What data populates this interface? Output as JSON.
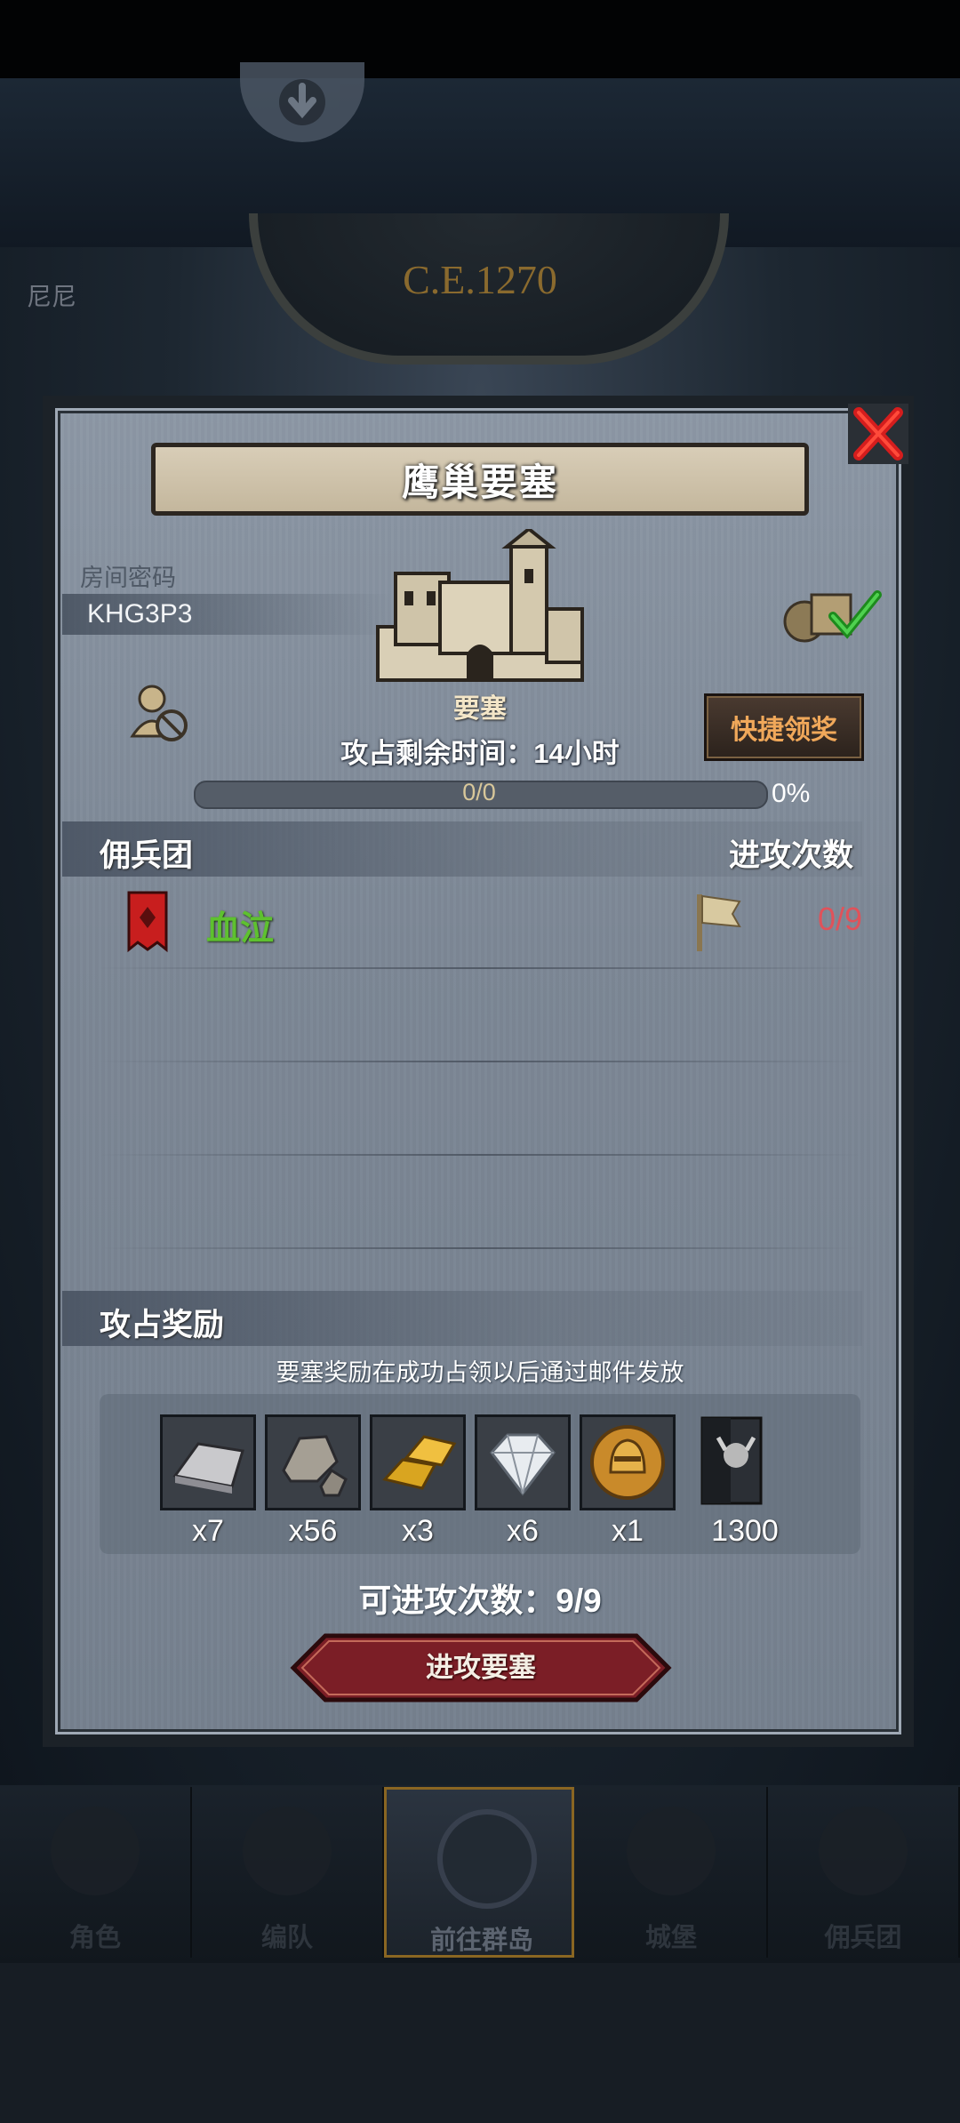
{
  "top": {
    "scroll_icon": "arrow-down-circle-icon"
  },
  "map": {
    "year": "C.E.1270",
    "left_label": "尼尼"
  },
  "dialog": {
    "title": "鹰巢要塞",
    "close_icon": "close-x-icon",
    "room_label": "房间密码",
    "room_code": "KHG3P3",
    "building_label": "要塞",
    "quick_claim_label": "快捷领奖",
    "remaining_time": "攻占剩余时间：14小时",
    "progress": {
      "text": "0/0",
      "percent_label": "0%",
      "value": 0
    },
    "mercenary_header": "佣兵团",
    "attacks_header": "进攻次数",
    "mercenaries": [
      {
        "name": "血泣",
        "attacks": "0/9",
        "banner_color": "#c81e1e"
      }
    ],
    "rewards_header": "攻占奖励",
    "rewards_note": "要塞奖励在成功占领以后通过邮件发放",
    "rewards": [
      {
        "icon": "iron-ingot-icon",
        "qty": "x7"
      },
      {
        "icon": "stone-ore-icon",
        "qty": "x56"
      },
      {
        "icon": "gold-bars-icon",
        "qty": "x3"
      },
      {
        "icon": "diamond-icon",
        "qty": "x6"
      },
      {
        "icon": "knight-helmet-coin-icon",
        "qty": "x1"
      },
      {
        "icon": "honor-banner-icon",
        "qty": "1300"
      }
    ],
    "available_attacks": "可进攻次数：9/9",
    "attack_button": "进攻要塞"
  },
  "nav": [
    {
      "label": "角色",
      "icon": "knight-icon"
    },
    {
      "label": "编队",
      "icon": "formation-icon"
    },
    {
      "label": "前往群岛",
      "icon": "islands-compass-icon",
      "active": true
    },
    {
      "label": "城堡",
      "icon": "castle-icon"
    },
    {
      "label": "佣兵团",
      "icon": "mercenary-icon"
    }
  ],
  "colors": {
    "accent_gold": "#c9a640",
    "merc_green": "#5ec12f",
    "count_red": "#e0525a",
    "claim_orange": "#f0a85a"
  }
}
